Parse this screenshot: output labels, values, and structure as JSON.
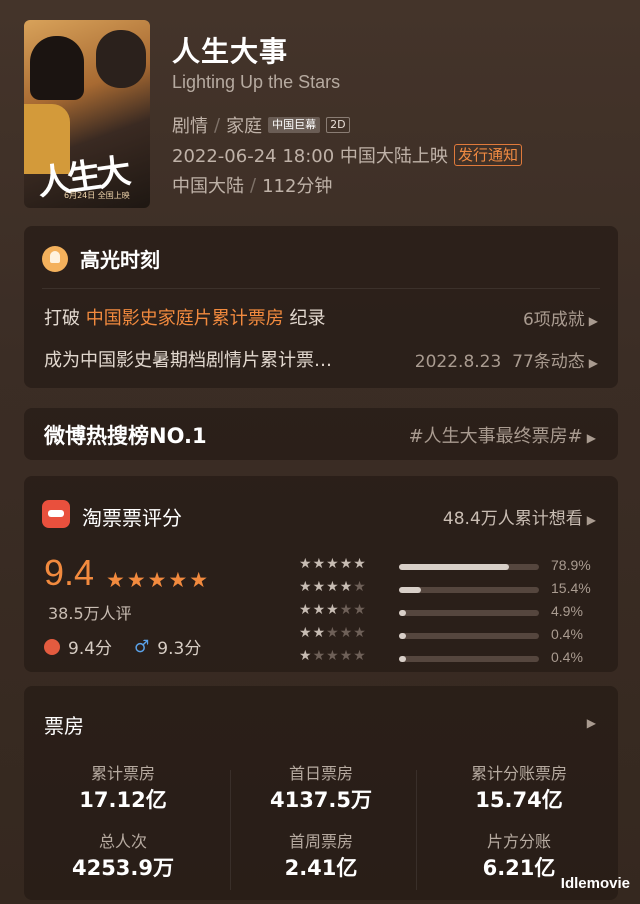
{
  "movie": {
    "poster_title": "人生大事",
    "poster_date": "6月24日 全国上映",
    "title": "人生大事",
    "english_title": "Lighting Up the Stars",
    "genres": [
      "剧情",
      "家庭"
    ],
    "badges": [
      "中国巨幕",
      "2D"
    ],
    "release": "2022-06-24 18:00 中国大陆上映",
    "notice_label": "发行通知",
    "country": "中国大陆",
    "duration": "112分钟"
  },
  "highlights": {
    "title": "高光时刻",
    "line1_prefix": "打破 ",
    "line1_highlight": "中国影史家庭片累计票房",
    "line1_suffix": " 纪录",
    "line1_right": "6项成就",
    "line2": "成为中国影史暑期档剧情片累计票…",
    "line2_date": "2022.8.23",
    "line2_right": "77条动态"
  },
  "weibo": {
    "left": "微博热搜榜NO.1",
    "right": "#人生大事最终票房#"
  },
  "taopiao": {
    "title": "淘票票评分",
    "want": "48.4万人累计想看",
    "score": "9.4",
    "stars": "★★★★★",
    "raters": "38.5万人评",
    "female_score": "9.4分",
    "male_icon": "♂",
    "male_score": "9.3分",
    "distribution": [
      {
        "stars": 5,
        "percent": 78.9,
        "label": "78.9%"
      },
      {
        "stars": 4,
        "percent": 15.4,
        "label": "15.4%"
      },
      {
        "stars": 3,
        "percent": 4.9,
        "label": "4.9%"
      },
      {
        "stars": 2,
        "percent": 0.4,
        "label": "0.4%"
      },
      {
        "stars": 1,
        "percent": 0.4,
        "label": "0.4%"
      }
    ]
  },
  "boxoffice": {
    "title": "票房",
    "cells": [
      {
        "label": "累计票房",
        "value": "17.12亿"
      },
      {
        "label": "首日票房",
        "value": "4137.5万"
      },
      {
        "label": "累计分账票房",
        "value": "15.74亿"
      },
      {
        "label": "总人次",
        "value": "4253.9万"
      },
      {
        "label": "首周票房",
        "value": "2.41亿"
      },
      {
        "label": "片方分账",
        "value": "6.21亿"
      }
    ]
  },
  "watermark": "Idlemovie",
  "colors": {
    "accent": "#f28a3e",
    "background": "#3a2c24"
  }
}
